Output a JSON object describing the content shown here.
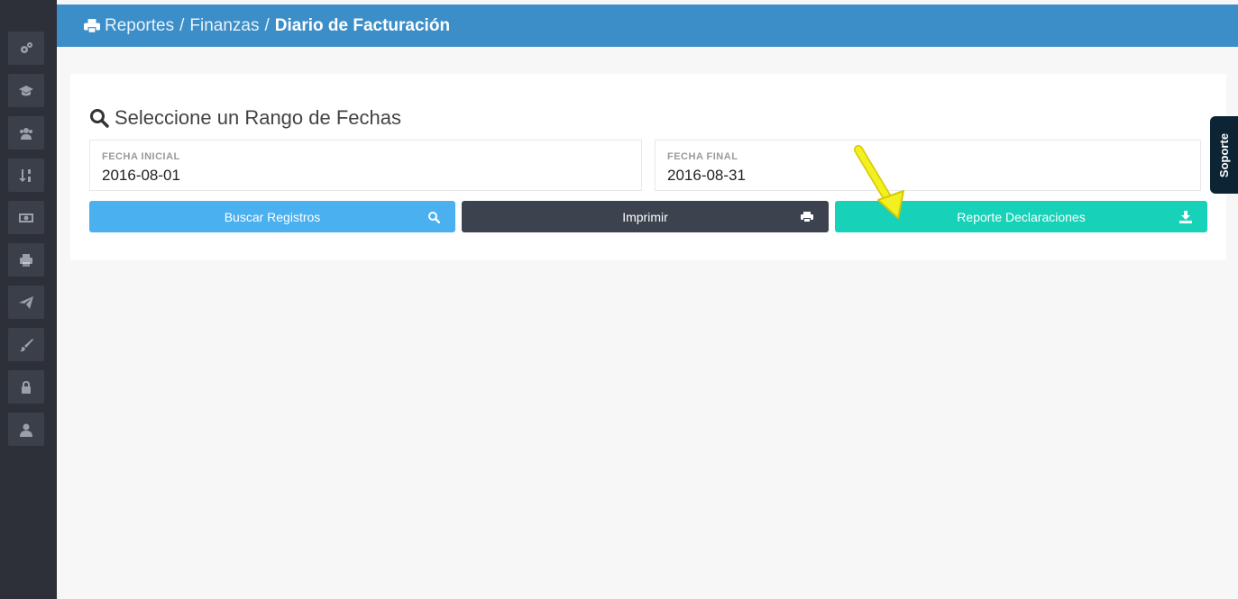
{
  "sidebar": {
    "items": [
      {
        "icon": "gears-icon"
      },
      {
        "icon": "graduation-cap-icon"
      },
      {
        "icon": "users-icon"
      },
      {
        "icon": "sort-numeric-icon"
      },
      {
        "icon": "money-icon"
      },
      {
        "icon": "print-icon"
      },
      {
        "icon": "paper-plane-icon"
      },
      {
        "icon": "paint-brush-icon"
      },
      {
        "icon": "lock-icon"
      },
      {
        "icon": "user-icon"
      }
    ]
  },
  "header": {
    "breadcrumb": [
      "Reportes",
      "Finanzas"
    ],
    "separator": "/",
    "current": "Diario de Facturación"
  },
  "card": {
    "title": "Seleccione un Rango de Fechas",
    "start_label": "FECHA INICIAL",
    "start_value": "2016-08-01",
    "end_label": "FECHA FINAL",
    "end_value": "2016-08-31"
  },
  "buttons": {
    "search": "Buscar Registros",
    "print": "Imprimir",
    "report": "Reporte Declaraciones"
  },
  "support": {
    "label": "Soporte"
  },
  "colors": {
    "header": "#3c8ec8",
    "search_button": "#4ab0f0",
    "print_button": "#3c434e",
    "report_button": "#17d1b8",
    "sidebar": "#2d3039",
    "support_tab": "#0c2434",
    "annotation_arrow": "#f3f021"
  }
}
